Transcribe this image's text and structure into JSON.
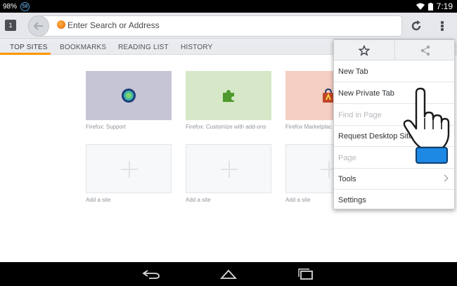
{
  "status_bar": {
    "battery_percent": "98%",
    "notification_count": "58",
    "time": "7:19"
  },
  "toolbar": {
    "tab_count": "1",
    "url_placeholder": "Enter Search or Address"
  },
  "panel_tabs": [
    {
      "label": "TOP SITES",
      "active": true
    },
    {
      "label": "BOOKMARKS",
      "active": false
    },
    {
      "label": "READING LIST",
      "active": false
    },
    {
      "label": "HISTORY",
      "active": false
    }
  ],
  "top_sites": [
    {
      "label": "Firefox: Support",
      "color": "#c5c5d6",
      "icon": "support-globe-icon"
    },
    {
      "label": "Firefox: Customize with add-ons",
      "color": "#d6e8c8",
      "icon": "puzzle-piece-icon"
    },
    {
      "label": "Firefox Marketplac",
      "color": "#f4cfc2",
      "icon": "marketplace-bag-icon"
    },
    {
      "label": "Add a site",
      "color": "#f6f8fa",
      "icon": "plus-icon"
    },
    {
      "label": "Add a site",
      "color": "#f6f8fa",
      "icon": "plus-icon"
    },
    {
      "label": "Add a site",
      "color": "#f6f8fa",
      "icon": "plus-icon"
    }
  ],
  "menu": {
    "top_icons": [
      "star-icon",
      "share-icon"
    ],
    "items": [
      {
        "label": "New Tab",
        "disabled": false
      },
      {
        "label": "New Private Tab",
        "disabled": false
      },
      {
        "label": "Find in Page",
        "disabled": true
      },
      {
        "label": "Request Desktop Site",
        "disabled": false,
        "checkbox": true
      },
      {
        "label": "Page",
        "disabled": true,
        "submenu": true
      },
      {
        "label": "Tools",
        "disabled": false,
        "submenu": true
      },
      {
        "label": "Settings",
        "disabled": false
      }
    ]
  },
  "colors": {
    "accent": "#ff9500",
    "cursor_cuff": "#1e88e5"
  },
  "nav_bar": {
    "icons": [
      "back-nav-icon",
      "home-nav-icon",
      "recents-nav-icon"
    ]
  }
}
